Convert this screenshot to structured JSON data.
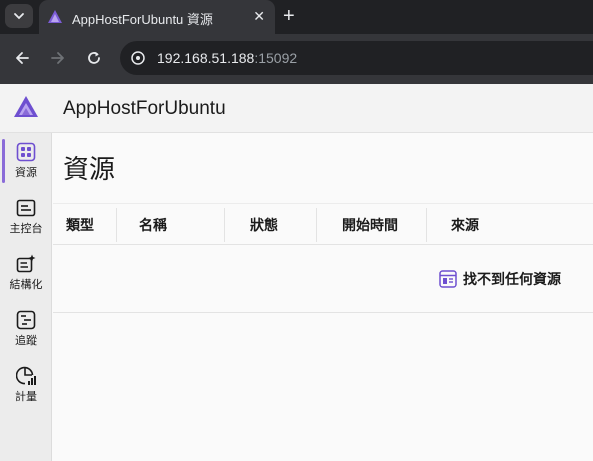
{
  "browser": {
    "tab_title": "AppHostForUbuntu 資源",
    "tab_close": "✕",
    "new_tab": "+",
    "url_host": "192.168.51.188",
    "url_port": ":15092"
  },
  "app": {
    "title": "AppHostForUbuntu",
    "accent_color": "#8a6bd8"
  },
  "sidebar": {
    "items": [
      {
        "label": "資源",
        "icon": "resources-grid-icon",
        "active": true
      },
      {
        "label": "主控台",
        "icon": "console-icon",
        "active": false
      },
      {
        "label": "結構化",
        "icon": "structured-logs-icon",
        "active": false
      },
      {
        "label": "追蹤",
        "icon": "traces-icon",
        "active": false
      },
      {
        "label": "計量",
        "icon": "metrics-icon",
        "active": false
      }
    ]
  },
  "main": {
    "title": "資源",
    "columns": [
      "類型",
      "名稱",
      "狀態",
      "開始時間",
      "來源"
    ],
    "empty_message": "找不到任何資源"
  }
}
